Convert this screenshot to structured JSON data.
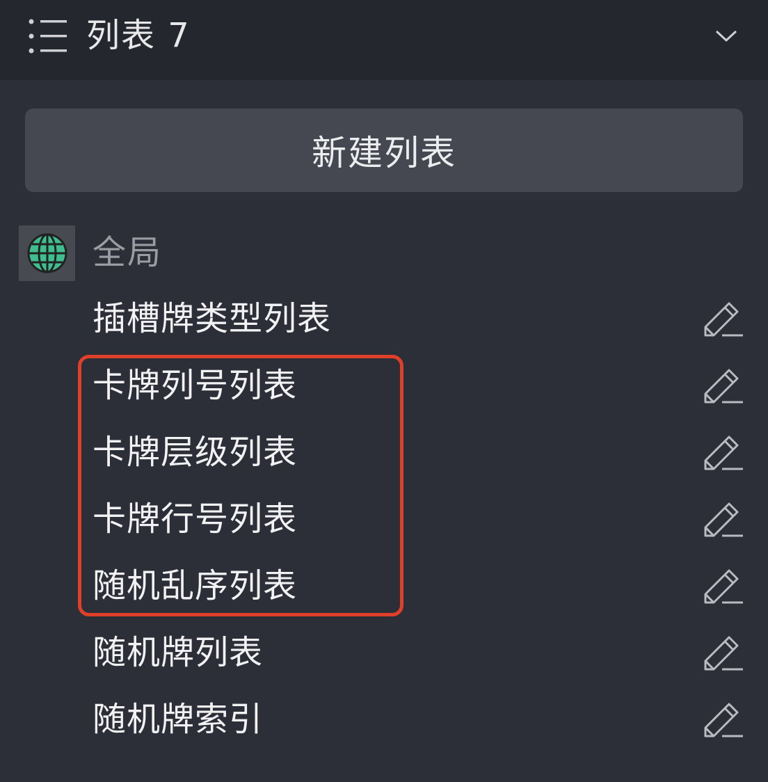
{
  "header": {
    "title": "列表 7",
    "menu_icon": "list-menu-icon",
    "collapse_icon": "chevron-down-icon"
  },
  "new_list_button": {
    "label": "新建列表"
  },
  "section": {
    "label": "全局",
    "icon": "globe-icon",
    "icon_color": "#3fbf8f"
  },
  "items": [
    {
      "label": "插槽牌类型列表",
      "action_icon": "edit-icon"
    },
    {
      "label": "卡牌列号列表",
      "action_icon": "edit-icon"
    },
    {
      "label": "卡牌层级列表",
      "action_icon": "edit-icon"
    },
    {
      "label": "卡牌行号列表",
      "action_icon": "edit-icon"
    },
    {
      "label": "随机乱序列表",
      "action_icon": "edit-icon"
    },
    {
      "label": "随机牌列表",
      "action_icon": "edit-icon"
    },
    {
      "label": "随机牌索引",
      "action_icon": "edit-icon"
    }
  ],
  "colors": {
    "background": "#2c2f37",
    "header_background": "#24272e",
    "button_background": "#454851",
    "highlight_border": "#e0402a"
  }
}
